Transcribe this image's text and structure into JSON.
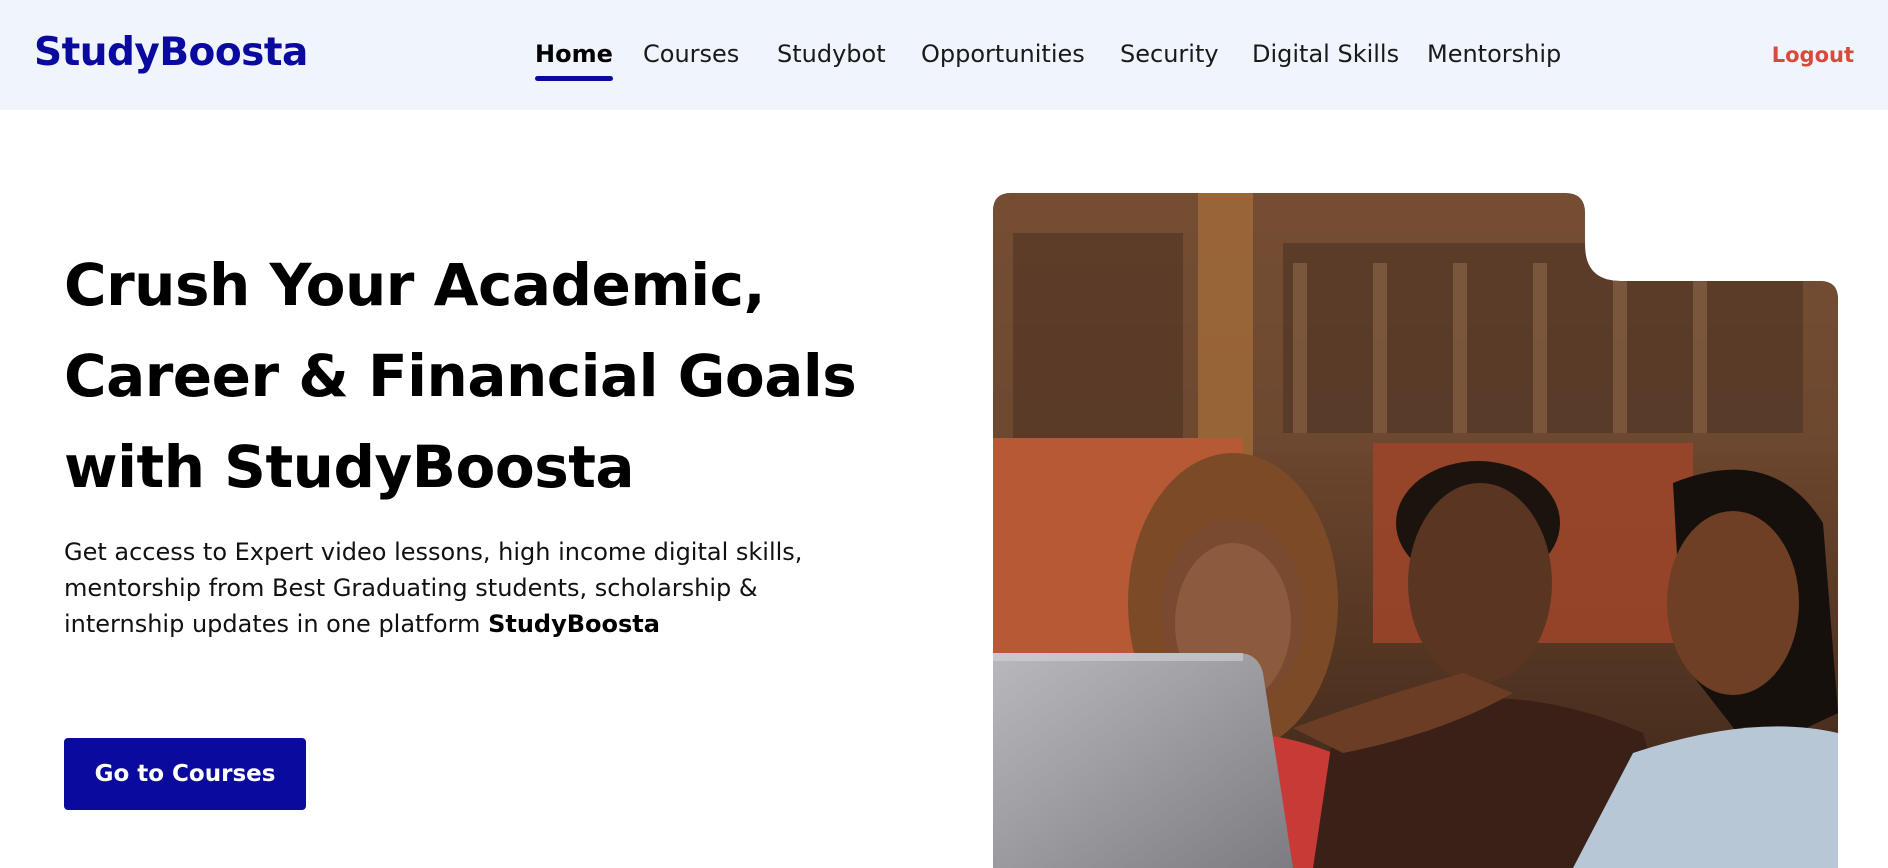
{
  "header": {
    "brand": "StudyBoosta",
    "nav": [
      {
        "label": "Home",
        "active": true
      },
      {
        "label": "Courses",
        "active": false
      },
      {
        "label": "Studybot",
        "active": false
      },
      {
        "label": "Opportunities",
        "active": false
      },
      {
        "label": "Security",
        "active": false
      },
      {
        "label": "Digital Skills",
        "active": false
      },
      {
        "label": "Mentorship",
        "active": false
      }
    ],
    "logout_label": "Logout"
  },
  "hero": {
    "title_lines": [
      "Crush Your Academic,",
      "Career & Financial Goals",
      "with StudyBoosta"
    ],
    "description": "Get access to Expert video lessons, high income digital skills, mentorship from Best Graduating students, scholarship & internship updates in one platform",
    "description_emphasis": "StudyBoosta",
    "cta_label": "Go to Courses"
  },
  "colors": {
    "brand": "#0a0a9e",
    "nav_background": "#eff4fd",
    "logout": "#d94a3c"
  }
}
